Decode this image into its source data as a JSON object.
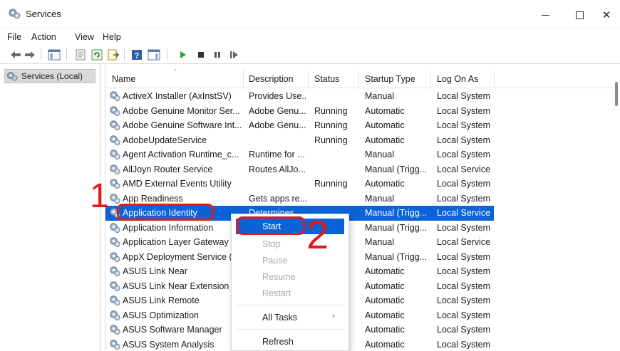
{
  "window": {
    "title": "Services",
    "min_glyph": "—",
    "close_glyph": "✕"
  },
  "menu": [
    "File",
    "Action",
    "View",
    "Help"
  ],
  "left_pane": {
    "item": "Services (Local)"
  },
  "table": {
    "columns": [
      "Name",
      "Description",
      "Status",
      "Startup Type",
      "Log On As"
    ],
    "rows": [
      {
        "name": "ActiveX Installer (AxInstSV)",
        "description": "Provides Use...",
        "status": "",
        "startup": "Manual",
        "logon": "Local System"
      },
      {
        "name": "Adobe Genuine Monitor Ser...",
        "description": "Adobe Genu...",
        "status": "Running",
        "startup": "Automatic",
        "logon": "Local System"
      },
      {
        "name": "Adobe Genuine Software Int...",
        "description": "Adobe Genu...",
        "status": "Running",
        "startup": "Automatic",
        "logon": "Local System"
      },
      {
        "name": "AdobeUpdateService",
        "description": "",
        "status": "Running",
        "startup": "Automatic",
        "logon": "Local System"
      },
      {
        "name": "Agent Activation Runtime_c...",
        "description": "Runtime for ...",
        "status": "",
        "startup": "Manual",
        "logon": "Local System"
      },
      {
        "name": "AllJoyn Router Service",
        "description": "Routes AllJo...",
        "status": "",
        "startup": "Manual (Trigg...",
        "logon": "Local Service"
      },
      {
        "name": "AMD External Events Utility",
        "description": "",
        "status": "Running",
        "startup": "Automatic",
        "logon": "Local System"
      },
      {
        "name": "App Readiness",
        "description": "Gets apps re...",
        "status": "",
        "startup": "Manual",
        "logon": "Local System"
      },
      {
        "name": "Application Identity",
        "description": "Determines ...",
        "status": "",
        "startup": "Manual (Trigg...",
        "logon": "Local Service",
        "selected": true
      },
      {
        "name": "Application Information",
        "description": "",
        "status": "",
        "startup": "Manual (Trigg...",
        "logon": "Local System"
      },
      {
        "name": "Application Layer Gateway S",
        "description": "",
        "status": "",
        "startup": "Manual",
        "logon": "Local Service"
      },
      {
        "name": "AppX Deployment Service (A",
        "description": "",
        "status": "",
        "startup": "Manual (Trigg...",
        "logon": "Local System"
      },
      {
        "name": "ASUS Link Near",
        "description": "",
        "status": "",
        "startup": "Automatic",
        "logon": "Local System"
      },
      {
        "name": "ASUS Link Near Extension",
        "description": "",
        "status": "",
        "startup": "Automatic",
        "logon": "Local System"
      },
      {
        "name": "ASUS Link Remote",
        "description": "",
        "status": "",
        "startup": "Automatic",
        "logon": "Local System"
      },
      {
        "name": "ASUS Optimization",
        "description": "",
        "status": "",
        "startup": "Automatic",
        "logon": "Local System"
      },
      {
        "name": "ASUS Software Manager",
        "description": "",
        "status": "",
        "startup": "Automatic",
        "logon": "Local System"
      },
      {
        "name": "ASUS System Analysis",
        "description": "",
        "status": "",
        "startup": "Automatic",
        "logon": "Local System"
      }
    ]
  },
  "context_menu": {
    "start": "Start",
    "stop": "Stop",
    "pause": "Pause",
    "resume": "Resume",
    "restart": "Restart",
    "all_tasks": "All Tasks",
    "all_tasks_arrow": "›",
    "refresh": "Refresh"
  },
  "annotations": {
    "step1": "1",
    "step2": "2"
  },
  "colors": {
    "selection": "#0a64d8",
    "annotation": "#e21a1a"
  }
}
